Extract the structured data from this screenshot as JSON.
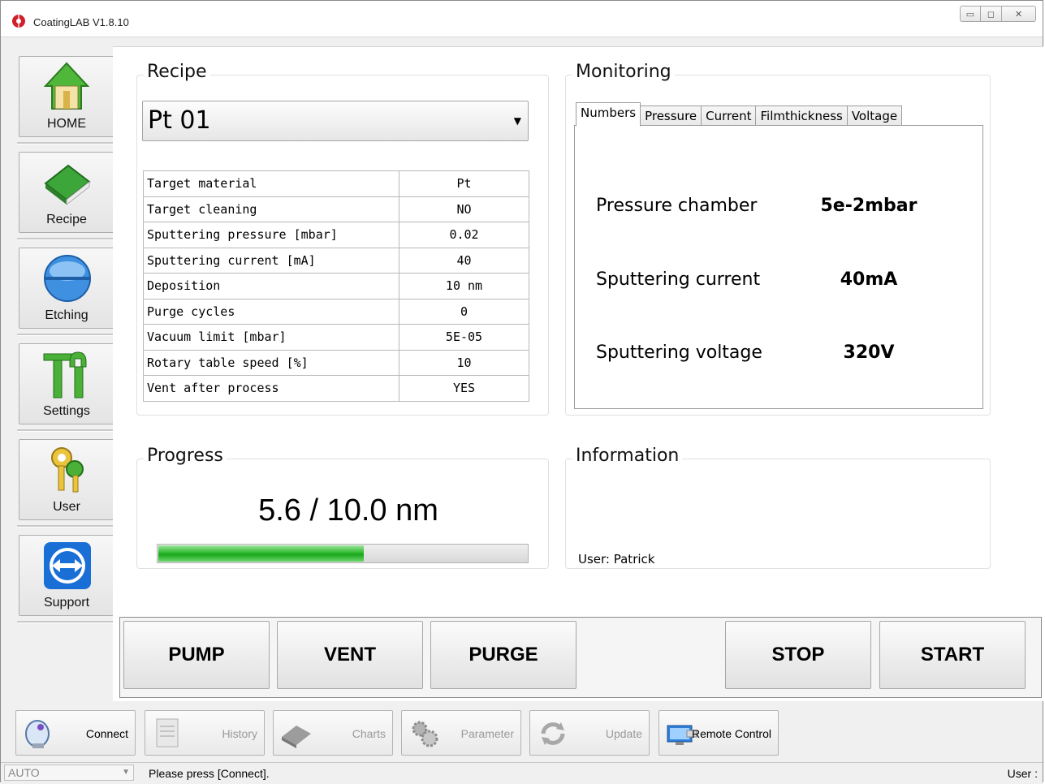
{
  "window": {
    "title": "CoatingLAB V1.8.10"
  },
  "nav": {
    "home": "HOME",
    "recipe": "Recipe",
    "etching": "Etching",
    "settings": "Settings",
    "user": "User",
    "support": "Support"
  },
  "recipe": {
    "title": "Recipe",
    "selected": "Pt 01",
    "params": [
      {
        "name": "Target material",
        "value": "Pt"
      },
      {
        "name": "Target cleaning",
        "value": "NO"
      },
      {
        "name": "Sputtering pressure [mbar]",
        "value": "0.02"
      },
      {
        "name": "Sputtering current [mA]",
        "value": "40"
      },
      {
        "name": "Deposition",
        "value": "10 nm"
      },
      {
        "name": "Purge cycles",
        "value": "0"
      },
      {
        "name": "Vacuum limit [mbar]",
        "value": "5E-05"
      },
      {
        "name": "Rotary table speed [%]",
        "value": "10"
      },
      {
        "name": "Vent after process",
        "value": "YES"
      }
    ]
  },
  "monitoring": {
    "title": "Monitoring",
    "tabs": [
      "Numbers",
      "Pressure",
      "Current",
      "Filmthickness",
      "Voltage"
    ],
    "active_tab": "Numbers",
    "rows": [
      {
        "label": "Pressure chamber",
        "value": "5e-2mbar"
      },
      {
        "label": "Sputtering current",
        "value": "40mA"
      },
      {
        "label": "Sputtering voltage",
        "value": "320V"
      }
    ]
  },
  "progress": {
    "title": "Progress",
    "text": "5.6 / 10.0 nm",
    "fraction": 0.56
  },
  "information": {
    "title": "Information",
    "user_line": "User: Patrick"
  },
  "actions": {
    "pump": "PUMP",
    "vent": "VENT",
    "purge": "PURGE",
    "stop": "STOP",
    "start": "START"
  },
  "toolbar": {
    "connect": "Connect",
    "history": "History",
    "charts": "Charts",
    "parameter": "Parameter",
    "update": "Update",
    "remote": "Remote Control"
  },
  "status": {
    "mode": "AUTO",
    "message": "Please press [Connect].",
    "user": "User :"
  },
  "colors": {
    "progress_fill": "#22b022",
    "app_icon": "#d0202a",
    "support_icon": "#1a6fd6"
  }
}
